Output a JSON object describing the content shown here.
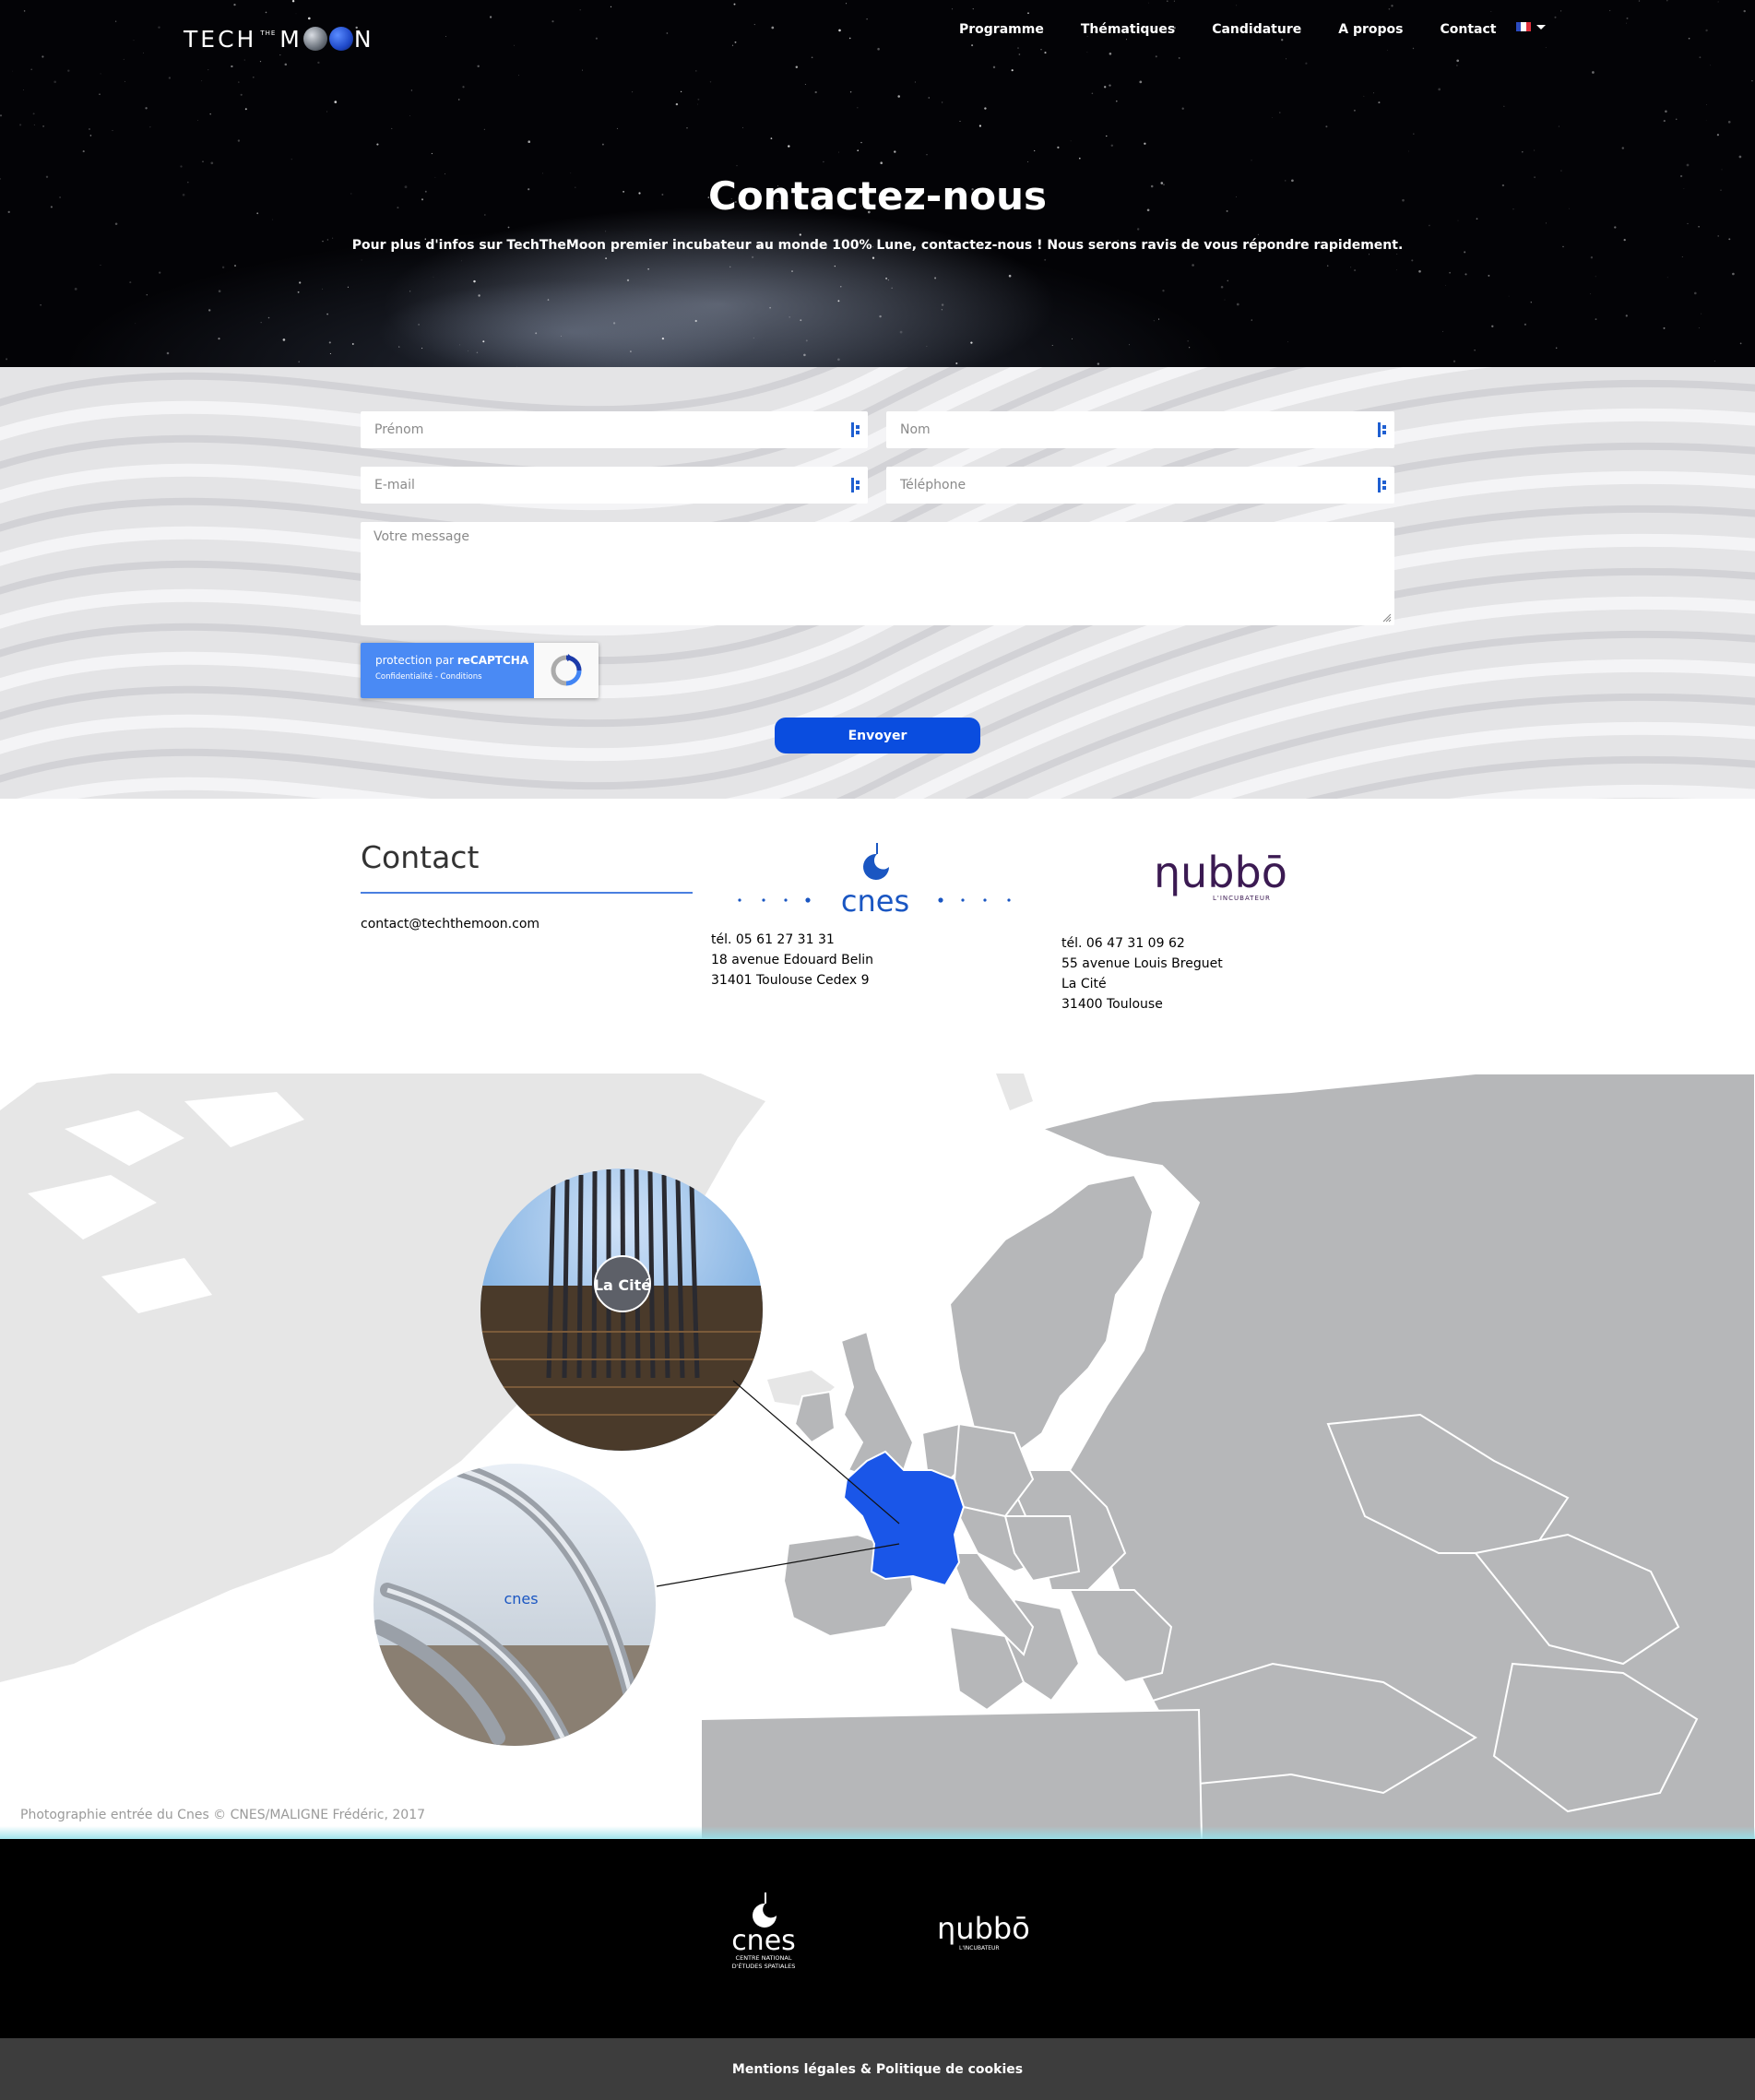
{
  "brand": {
    "logo_text": [
      "TECH",
      "THE",
      "M",
      "N"
    ]
  },
  "nav": {
    "items": [
      "Programme",
      "Thématiques",
      "Candidature",
      "A propos",
      "Contact"
    ],
    "language_flag": "fr"
  },
  "hero": {
    "title": "Contactez-nous",
    "subtitle": "Pour plus d'infos sur TechTheMoon premier incubateur au monde 100% Lune, contactez-nous ! Nous serons ravis de vous répondre rapidement."
  },
  "form": {
    "first_name_placeholder": "Prénom",
    "last_name_placeholder": "Nom",
    "email_placeholder": "E-mail",
    "phone_placeholder": "Téléphone",
    "message_placeholder": "Votre message",
    "captcha_line1_prefix": "protection par ",
    "captcha_line1_brand": "reCAPTCHA",
    "captcha_line2": "Confidentialité - Conditions",
    "submit_label": "Envoyer"
  },
  "contact": {
    "title": "Contact",
    "email": "contact@techthemoon.com",
    "cnes": {
      "logo_text": "cnes",
      "lines": [
        "tél. 05 61 27 31 31",
        "18 avenue Edouard Belin",
        "31401 Toulouse Cedex 9"
      ]
    },
    "nubbo": {
      "logo_text": "ηubbō",
      "logo_tag": "L'INCUBATEUR",
      "lines": [
        "tél. 06 47 31 09 62",
        "55 avenue Louis Breguet",
        "La Cité",
        "31400 Toulouse"
      ]
    }
  },
  "map": {
    "la_cite_label": "La Cité",
    "photo_credit": "Photographie entrée du Cnes © CNES/MALIGNE Frédéric, 2017",
    "highlight_color": "#1a56e8"
  },
  "footer": {
    "cnes_logo_text": "cnes",
    "cnes_tagline": [
      "CENTRE NATIONAL",
      "D'ÉTUDES SPATIALES"
    ],
    "nubbo_logo_text": "ηubbō",
    "nubbo_tag": "L'INCUBATEUR",
    "legal_link": "Mentions légales & Politique de cookies"
  },
  "colors": {
    "accent": "#0a4ddf",
    "footer_bg": "#000000",
    "bottom_bar": "#3d3d3d"
  }
}
